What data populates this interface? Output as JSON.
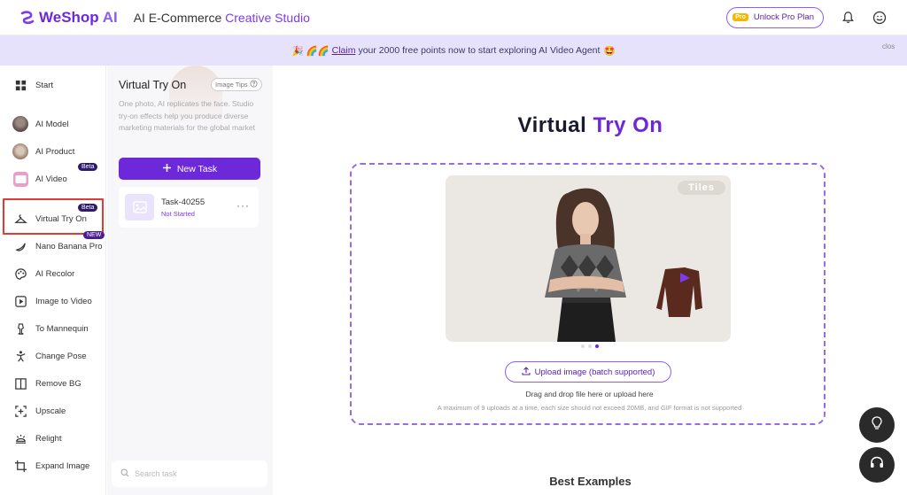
{
  "header": {
    "logo_we": "WeShop",
    "logo_ai": "AI",
    "title_prefix": "AI E-Commerce",
    "title_highlight": "Creative Studio",
    "pro_badge": "Pro",
    "unlock_label": "Unlock Pro Plan"
  },
  "banner": {
    "emoji_prefix": "🎉 🌈🌈",
    "claim_link": "Claim",
    "message": "your 2000 free points now to start exploring AI Video Agent",
    "emoji_suffix": "🤩",
    "close_text": "clos"
  },
  "sidebar": {
    "items": [
      {
        "label": "Start",
        "icon": "grid-icon"
      },
      {
        "label": "AI Model",
        "icon": "avatar-icon"
      },
      {
        "label": "AI Product",
        "icon": "avatar-icon"
      },
      {
        "label": "AI Video",
        "icon": "video-icon",
        "badge": "Beta"
      },
      {
        "label": "Virtual Try On",
        "icon": "hanger-icon",
        "badge": "Beta"
      },
      {
        "label": "Nano Banana Pro",
        "icon": "banana-icon",
        "badge": "NEW"
      },
      {
        "label": "AI Recolor",
        "icon": "palette-icon"
      },
      {
        "label": "Image to Video",
        "icon": "play-icon"
      },
      {
        "label": "To Mannequin",
        "icon": "mannequin-icon"
      },
      {
        "label": "Change Pose",
        "icon": "pose-icon"
      },
      {
        "label": "Remove BG",
        "icon": "remove-bg-icon"
      },
      {
        "label": "Upscale",
        "icon": "upscale-icon"
      },
      {
        "label": "Relight",
        "icon": "relight-icon"
      },
      {
        "label": "Expand Image",
        "icon": "expand-icon"
      }
    ]
  },
  "task_panel": {
    "title": "Virtual Try On",
    "tips_label": "Image Tips",
    "description": "One photo, AI replicates the face. Studio try-on effects help you produce diverse marketing materials for the global market",
    "new_task_label": "New Task",
    "tasks": [
      {
        "name": "Task-40255",
        "status": "Not Started"
      }
    ],
    "search_placeholder": "Search task"
  },
  "main": {
    "title_prefix": "Virtual",
    "title_highlight": "Try On",
    "preview_label": "Tiles",
    "upload_label": "Upload image (batch supported)",
    "drag_text": "Drag and drop file here or upload here",
    "limit_text": "A maximum of 9 uploads at a time, each size should not exceed 20MB, and GIF format is not supported",
    "best_examples": "Best Examples"
  },
  "colors": {
    "accent": "#6d28d9",
    "banner_bg": "#e6e2fb",
    "highlight_border": "#e53935"
  }
}
